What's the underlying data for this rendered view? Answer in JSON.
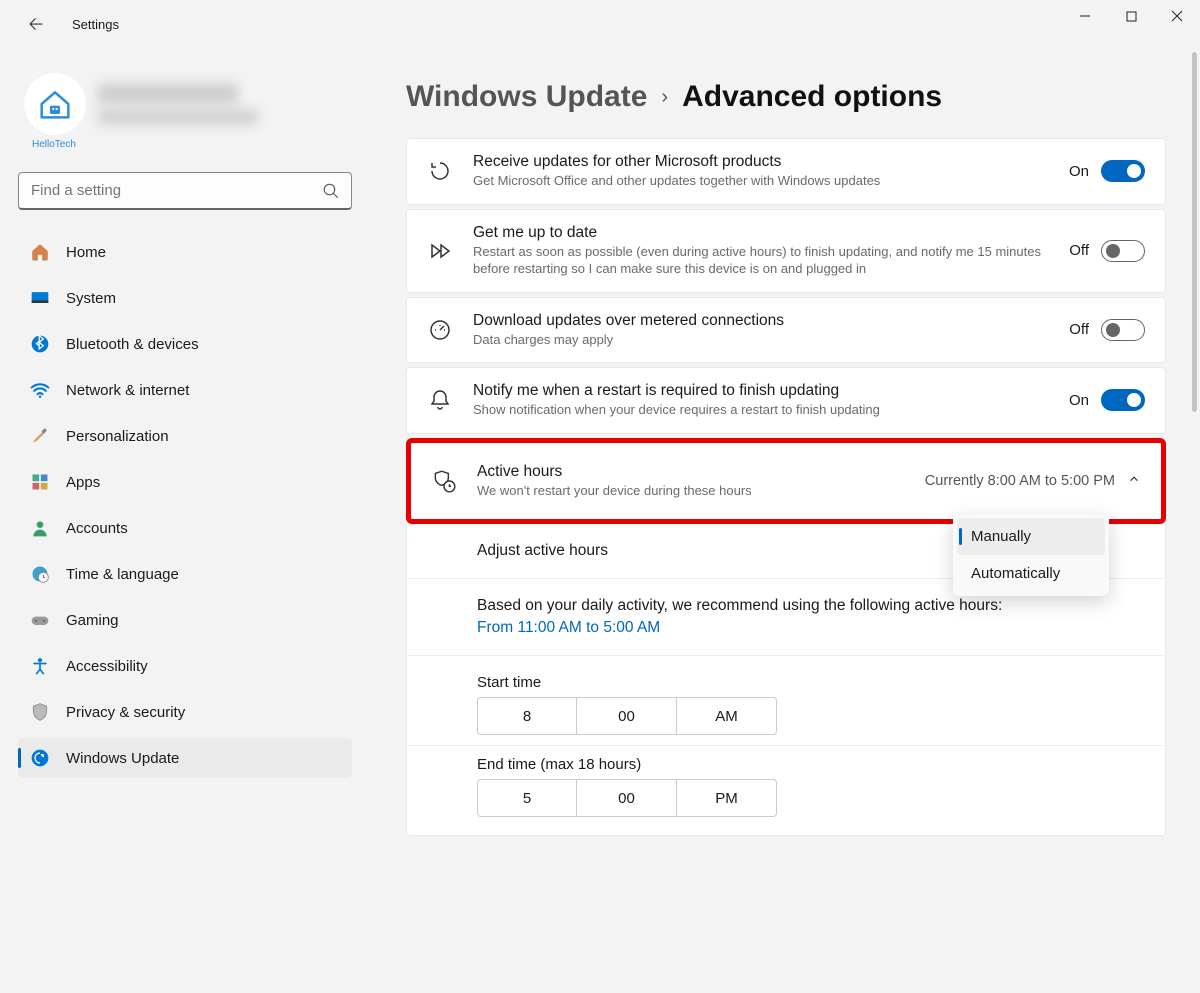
{
  "app_title": "Settings",
  "window_controls": {
    "min": "—",
    "max": "❐",
    "close": "✕"
  },
  "profile": {
    "logo_label": "HelloTech"
  },
  "search": {
    "placeholder": "Find a setting"
  },
  "sidebar": {
    "items": [
      {
        "label": "Home"
      },
      {
        "label": "System"
      },
      {
        "label": "Bluetooth & devices"
      },
      {
        "label": "Network & internet"
      },
      {
        "label": "Personalization"
      },
      {
        "label": "Apps"
      },
      {
        "label": "Accounts"
      },
      {
        "label": "Time & language"
      },
      {
        "label": "Gaming"
      },
      {
        "label": "Accessibility"
      },
      {
        "label": "Privacy & security"
      },
      {
        "label": "Windows Update"
      }
    ]
  },
  "breadcrumb": {
    "parent": "Windows Update",
    "sep": "›",
    "current": "Advanced options"
  },
  "cards": {
    "receive": {
      "title": "Receive updates for other Microsoft products",
      "sub": "Get Microsoft Office and other updates together with Windows updates",
      "state_label": "On"
    },
    "uptodate": {
      "title": "Get me up to date",
      "sub": "Restart as soon as possible (even during active hours) to finish updating, and notify me 15 minutes before restarting so I can make sure this device is on and plugged in",
      "state_label": "Off"
    },
    "metered": {
      "title": "Download updates over metered connections",
      "sub": "Data charges may apply",
      "state_label": "Off"
    },
    "notify": {
      "title": "Notify me when a restart is required to finish updating",
      "sub": "Show notification when your device requires a restart to finish updating",
      "state_label": "On"
    },
    "active": {
      "title": "Active hours",
      "sub": "We won't restart your device during these hours",
      "right": "Currently 8:00 AM to 5:00 PM"
    }
  },
  "active_hours": {
    "adjust_label": "Adjust active hours",
    "rec_text": "Based on your daily activity, we recommend using the following active hours:",
    "rec_link": "From 11:00 AM to 5:00 AM",
    "start_label": "Start time",
    "end_label": "End time (max 18 hours)",
    "start": {
      "h": "8",
      "m": "00",
      "ap": "AM"
    },
    "end": {
      "h": "5",
      "m": "00",
      "ap": "PM"
    },
    "dropdown": {
      "opt1": "Manually",
      "opt2": "Automatically"
    }
  }
}
